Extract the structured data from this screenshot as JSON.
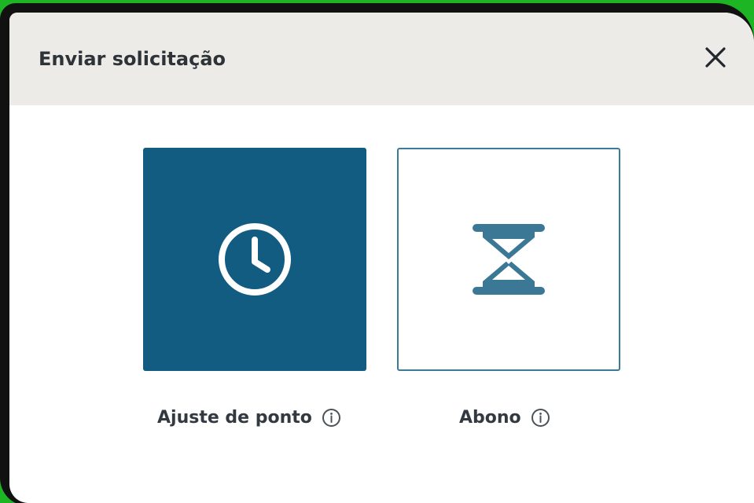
{
  "dialog": {
    "title": "Enviar solicitação",
    "close_icon": "close-icon"
  },
  "options": [
    {
      "label": "Ajuste de ponto",
      "icon": "clock-icon",
      "info_icon": "info-icon",
      "selected": true
    },
    {
      "label": "Abono",
      "icon": "hourglass-icon",
      "info_icon": "info-icon",
      "selected": false
    }
  ],
  "colors": {
    "background": "#1db523",
    "frame": "#111111",
    "header": "#ecebe8",
    "primary": "#115c80",
    "outline": "#3c7b98",
    "text": "#333940"
  }
}
